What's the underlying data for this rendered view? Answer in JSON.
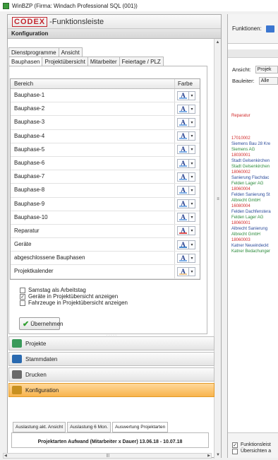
{
  "window": {
    "title": "WinBZP (Firma: Windach Professional SQL  (001))"
  },
  "toolbar": {
    "logo": "CODEX",
    "logo_suffix": "-Funktionsleiste"
  },
  "config": {
    "header": "Konfiguration"
  },
  "tabs_row1": [
    "Dienstprogramme",
    "Ansicht"
  ],
  "tabs_row2": [
    "Bauphasen",
    "Projektübersicht",
    "Mitarbeiter",
    "Feiertage / PLZ"
  ],
  "grid": {
    "col_area": "Bereich",
    "col_color": "Farbe",
    "rows": [
      {
        "label": "Bauphase-1",
        "color": "#7fb0e8"
      },
      {
        "label": "Bauphase-2",
        "color": "#7fb0e8"
      },
      {
        "label": "Bauphase-3",
        "color": "#7fb0e8"
      },
      {
        "label": "Bauphase-4",
        "color": "#7fb0e8"
      },
      {
        "label": "Bauphase-5",
        "color": "#7fb0e8"
      },
      {
        "label": "Bauphase-6",
        "color": "#7fb0e8"
      },
      {
        "label": "Bauphase-7",
        "color": "#7fb0e8"
      },
      {
        "label": "Bauphase-8",
        "color": "#7fb0e8"
      },
      {
        "label": "Bauphase-9",
        "color": "#7fb0e8"
      },
      {
        "label": "Bauphase-10",
        "color": "#7fb0e8"
      },
      {
        "label": "Reparatur",
        "color": "#e05050"
      },
      {
        "label": "Geräte",
        "color": "#4a8ad0"
      },
      {
        "label": "abgeschlossene Bauphasen",
        "color": "#7fb0e8"
      },
      {
        "label": "Projektkalender",
        "color": "#f0c890"
      }
    ]
  },
  "options": [
    {
      "label": "Samstag als Arbeitstag",
      "checked": false
    },
    {
      "label": "Geräte in Projektübersicht anzeigen",
      "checked": true
    },
    {
      "label": "Fahrzeuge in Projektübersicht anzeigen",
      "checked": false
    }
  ],
  "apply_button": "Übernehmen",
  "nav": [
    {
      "label": "Projekte",
      "icon": "projects-icon",
      "color": "#3a9a5a"
    },
    {
      "label": "Stammdaten",
      "icon": "database-icon",
      "color": "#2a6ab0"
    },
    {
      "label": "Drucken",
      "icon": "printer-icon",
      "color": "#6a6a6a"
    },
    {
      "label": "Konfiguration",
      "icon": "wrench-icon",
      "color": "#c89020",
      "active": true
    }
  ],
  "bottom_tabs": [
    "Auslastung akt. Ansicht",
    "Auslastung 6 Mon.",
    "Auswertung Projektarten"
  ],
  "bottom_title": "Projektarten Aufwand (Mitarbeiter x Dauer) 13.06.18 - 10.07.18",
  "right": {
    "functions_label": "Funktionen:",
    "view_label": "Ansicht:",
    "view_value": "Projek",
    "manager_label": "Bauleiter:",
    "manager_value": "Alle",
    "entries": [
      {
        "text": "Reparatur",
        "cls": "red"
      },
      {
        "text": "",
        "cls": "blue"
      },
      {
        "text": "",
        "cls": "blue"
      },
      {
        "text": "",
        "cls": "blue"
      },
      {
        "text": "17010002",
        "cls": "red"
      },
      {
        "text": "Siemens Bau 28 Kre",
        "cls": "blue"
      },
      {
        "text": "Siemens AG",
        "cls": "green"
      },
      {
        "text": "18030001",
        "cls": "red"
      },
      {
        "text": "Stadt Gelsenkirchen",
        "cls": "blue"
      },
      {
        "text": "Stadt Gelsenkirchen",
        "cls": "green"
      },
      {
        "text": "18060002",
        "cls": "red"
      },
      {
        "text": "Sanierung Flachdac",
        "cls": "blue"
      },
      {
        "text": "Felden Lager AG",
        "cls": "green"
      },
      {
        "text": "18060004",
        "cls": "red"
      },
      {
        "text": "Felden Sanierung St",
        "cls": "blue"
      },
      {
        "text": "Albrecht GmbH",
        "cls": "green"
      },
      {
        "text": "16080004",
        "cls": "red"
      },
      {
        "text": "Felden Dachfenstera",
        "cls": "blue"
      },
      {
        "text": "Felden Lager AG",
        "cls": "green"
      },
      {
        "text": "18060001",
        "cls": "red"
      },
      {
        "text": "Albrecht Sanierung",
        "cls": "blue"
      },
      {
        "text": "Albrecht GmbH",
        "cls": "green"
      },
      {
        "text": "18060003",
        "cls": "red"
      },
      {
        "text": "Katner Neueindeckt",
        "cls": "blue"
      },
      {
        "text": "Katner Bedachunger",
        "cls": "green"
      }
    ],
    "footer_opt1": "Funktionsleist",
    "footer_opt2": "Übersichten a"
  }
}
